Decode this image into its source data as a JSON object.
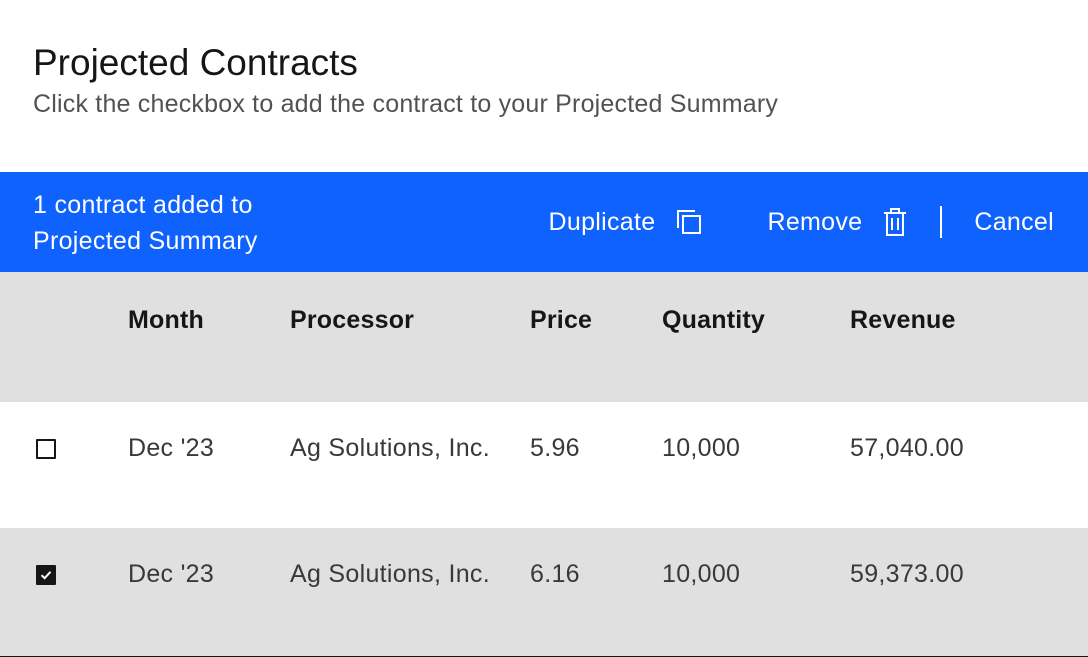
{
  "header": {
    "title": "Projected Contracts",
    "subtitle": "Click the checkbox to add the contract to your Projected Summary"
  },
  "batch_bar": {
    "summary": "1 contract added to Projected Summary",
    "duplicate_label": "Duplicate",
    "duplicate_icon": "copy-icon",
    "remove_label": "Remove",
    "remove_icon": "trash-icon",
    "cancel_label": "Cancel",
    "background_color": "#0f62fe"
  },
  "table": {
    "columns": [
      "Month",
      "Processor",
      "Price",
      "Quantity",
      "Revenue"
    ],
    "rows": [
      {
        "selected": false,
        "month": "Dec '23",
        "processor": "Ag Solutions, Inc.",
        "price": "5.96",
        "quantity": "10,000",
        "revenue": "57,040.00"
      },
      {
        "selected": true,
        "month": "Dec '23",
        "processor": "Ag Solutions, Inc.",
        "price": "6.16",
        "quantity": "10,000",
        "revenue": "59,373.00"
      }
    ]
  }
}
